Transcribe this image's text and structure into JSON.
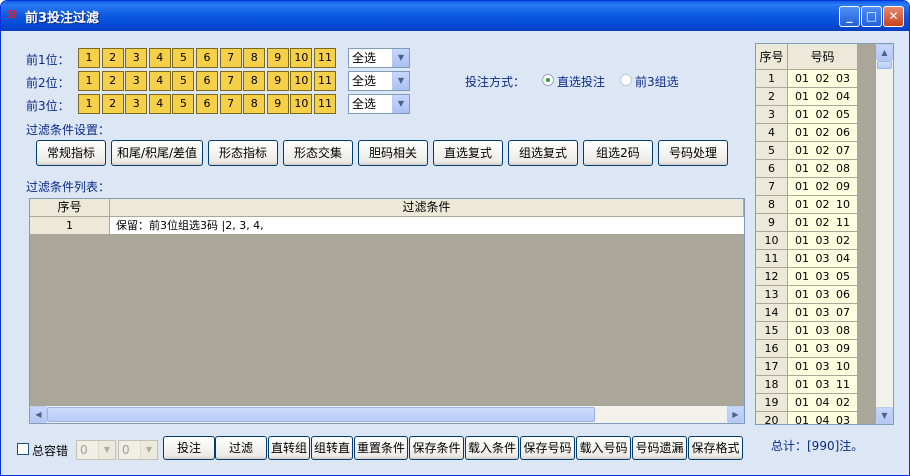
{
  "window": {
    "title": "前3投注过滤"
  },
  "rows": [
    {
      "label": "前1位：",
      "select": "全选"
    },
    {
      "label": "前2位：",
      "select": "全选"
    },
    {
      "label": "前3位：",
      "select": "全选"
    }
  ],
  "numbers": [
    "1",
    "2",
    "3",
    "4",
    "5",
    "6",
    "7",
    "8",
    "9",
    "10",
    "11"
  ],
  "bet_mode": {
    "label": "投注方式：",
    "options": [
      {
        "label": "直选投注",
        "selected": true
      },
      {
        "label": "前3组选",
        "selected": false
      }
    ]
  },
  "filter_settings": {
    "heading": "过滤条件设置：",
    "buttons": [
      "常规指标",
      "和尾/积尾/差值",
      "形态指标",
      "形态交集",
      "胆码相关",
      "直选复式",
      "组选复式",
      "组选2码",
      "号码处理"
    ]
  },
  "filter_list": {
    "heading": "过滤条件列表：",
    "columns": [
      "序号",
      "过滤条件"
    ],
    "rows": [
      {
        "index": "1",
        "condition": "保留：前3位组选3码 |2, 3, 4,"
      }
    ]
  },
  "results": {
    "columns": [
      "序号",
      "号码"
    ],
    "rows": [
      [
        "1",
        "01 02 03"
      ],
      [
        "2",
        "01 02 04"
      ],
      [
        "3",
        "01 02 05"
      ],
      [
        "4",
        "01 02 06"
      ],
      [
        "5",
        "01 02 07"
      ],
      [
        "6",
        "01 02 08"
      ],
      [
        "7",
        "01 02 09"
      ],
      [
        "8",
        "01 02 10"
      ],
      [
        "9",
        "01 02 11"
      ],
      [
        "10",
        "01 03 02"
      ],
      [
        "11",
        "01 03 04"
      ],
      [
        "12",
        "01 03 05"
      ],
      [
        "13",
        "01 03 06"
      ],
      [
        "14",
        "01 03 07"
      ],
      [
        "15",
        "01 03 08"
      ],
      [
        "16",
        "01 03 09"
      ],
      [
        "17",
        "01 03 10"
      ],
      [
        "18",
        "01 03 11"
      ],
      [
        "19",
        "01 04 02"
      ],
      [
        "20",
        "01 04 03"
      ]
    ],
    "total": "总计：[990]注。"
  },
  "bottom": {
    "tolerance_label": "总容错",
    "tolerance_min": "0",
    "tolerance_max": "0",
    "buttons": [
      "投注",
      "过滤",
      "直转组",
      "组转直",
      "重置条件",
      "保存条件",
      "载入条件",
      "保存号码",
      "载入号码",
      "号码遗漏",
      "保存格式"
    ]
  }
}
